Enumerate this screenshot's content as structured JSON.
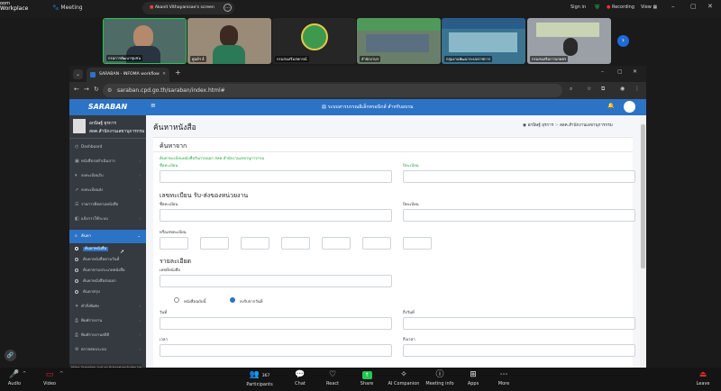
{
  "zoom_top": {
    "brand": "Zoom Workplace",
    "brand_line1": "oom",
    "brand_line2": "Workplace",
    "meeting_label": "Meeting",
    "share_notice": "Akanit Vithayanisae's screen",
    "sign_in": "Sign in",
    "recording": "Recording",
    "view": "View"
  },
  "thumbnails": [
    {
      "name": "กรมการพัฒนาชุมชน",
      "bg": "#4f6b66"
    },
    {
      "name": "ศูนย์ฯ 4",
      "bg": "#9a8a78"
    },
    {
      "name": "กรมส่งเสริมสหกรณ์",
      "bg": "#262626"
    },
    {
      "name": "สำนักงานฯ",
      "bg": "#6a7f6a"
    },
    {
      "name": "กลุ่มงานพัฒนาระบบราชการ",
      "bg": "#3a7490"
    },
    {
      "name": "กรมส่งเสริมการเกษตร",
      "bg": "#9aa0a6"
    }
  ],
  "browser": {
    "tab_title": "SARABAN - INFOMA workflow",
    "url": "saraban.cpd.go.th/saraban/index.html#",
    "status_url": "https://saraban.cpd.go.th/saraban/index.html#"
  },
  "app": {
    "logo": "SARABAN",
    "header_title": "ระบบสารบรรณอิเล็กทรอนิกส์ สำหรับอบรม",
    "user_name": "อกนิษฐ์ ยุรการ",
    "user_dept": "สลค.สำนักงานเลขานุการกรม"
  },
  "sidebar": {
    "items": [
      {
        "label": "Dashboard"
      },
      {
        "label": "หนังสือรอดำเนินการ"
      },
      {
        "label": "ลงทะเบียนรับ"
      },
      {
        "label": "ลงทะเบียนส่ง"
      },
      {
        "label": "รายการติดตามหนังสือ"
      },
      {
        "label": "แจ้งการใช้ระบบ"
      },
      {
        "label": "ค้นหา"
      }
    ],
    "sub_items": [
      {
        "label": "ค้นหาหนังสือ"
      },
      {
        "label": "ค้นหาหนังสือตามวันที่"
      },
      {
        "label": "ค้นหาตามประเภทหนังสือ"
      },
      {
        "label": "ค้นหาหนังสือส่งออก"
      },
      {
        "label": "ค้นหาสรุป"
      }
    ],
    "items_after": [
      {
        "label": "คำสั่งพิเศษ"
      },
      {
        "label": "พิมพ์รายงาน"
      },
      {
        "label": "พิมพ์รายงานสถิติ"
      },
      {
        "label": "ตรวจสอบระบบ"
      }
    ]
  },
  "page": {
    "title": "ค้นหาหนังสือ",
    "breadcrumb_user": "อกนิษฐ์ ยุรการ",
    "breadcrumb_dept": "สลค.สำนักงานเลขานุการกรม",
    "section_source": "ค้นหาจาก",
    "source_note": "ค้นหาทะเบียนหนังสือรับภายนอก สลค.สำนักงานเลขานุการกรม",
    "label_reg_name": "ชื่อทะเบียน",
    "label_reg_year": "ปีทะเบียน",
    "section_regno": "เลขทะเบียน รับ-ส่งของหน่วยงาน",
    "label_reg_name2": "ชื่อทะเบียน",
    "label_reg_year2": "ปีทะเบียน",
    "label_reg_no": "หรือเลขทะเบียน",
    "section_detail": "รายละเอียด",
    "label_subject": "เลขที่หนังสือ",
    "radio_1": "หนังสือฉบับนี้",
    "radio_2": "ลงรับจากวันที่",
    "label_date_from": "วันที่",
    "label_date_to": "ถึงวันที่",
    "label_time_from": "เวลา",
    "label_time_to": "ถึงเวลา"
  },
  "zoom_bar": {
    "audio": "Audio",
    "video": "Video",
    "participants": "Participants",
    "participants_count": "367",
    "chat": "Chat",
    "react": "React",
    "share": "Share",
    "ai": "AI Companion",
    "info": "Meeting info",
    "apps": "Apps",
    "more": "More",
    "leave": "Leave"
  },
  "colors": {
    "accent": "#2c73c5",
    "share_green": "#23c552",
    "leave_red": "#e02828"
  }
}
